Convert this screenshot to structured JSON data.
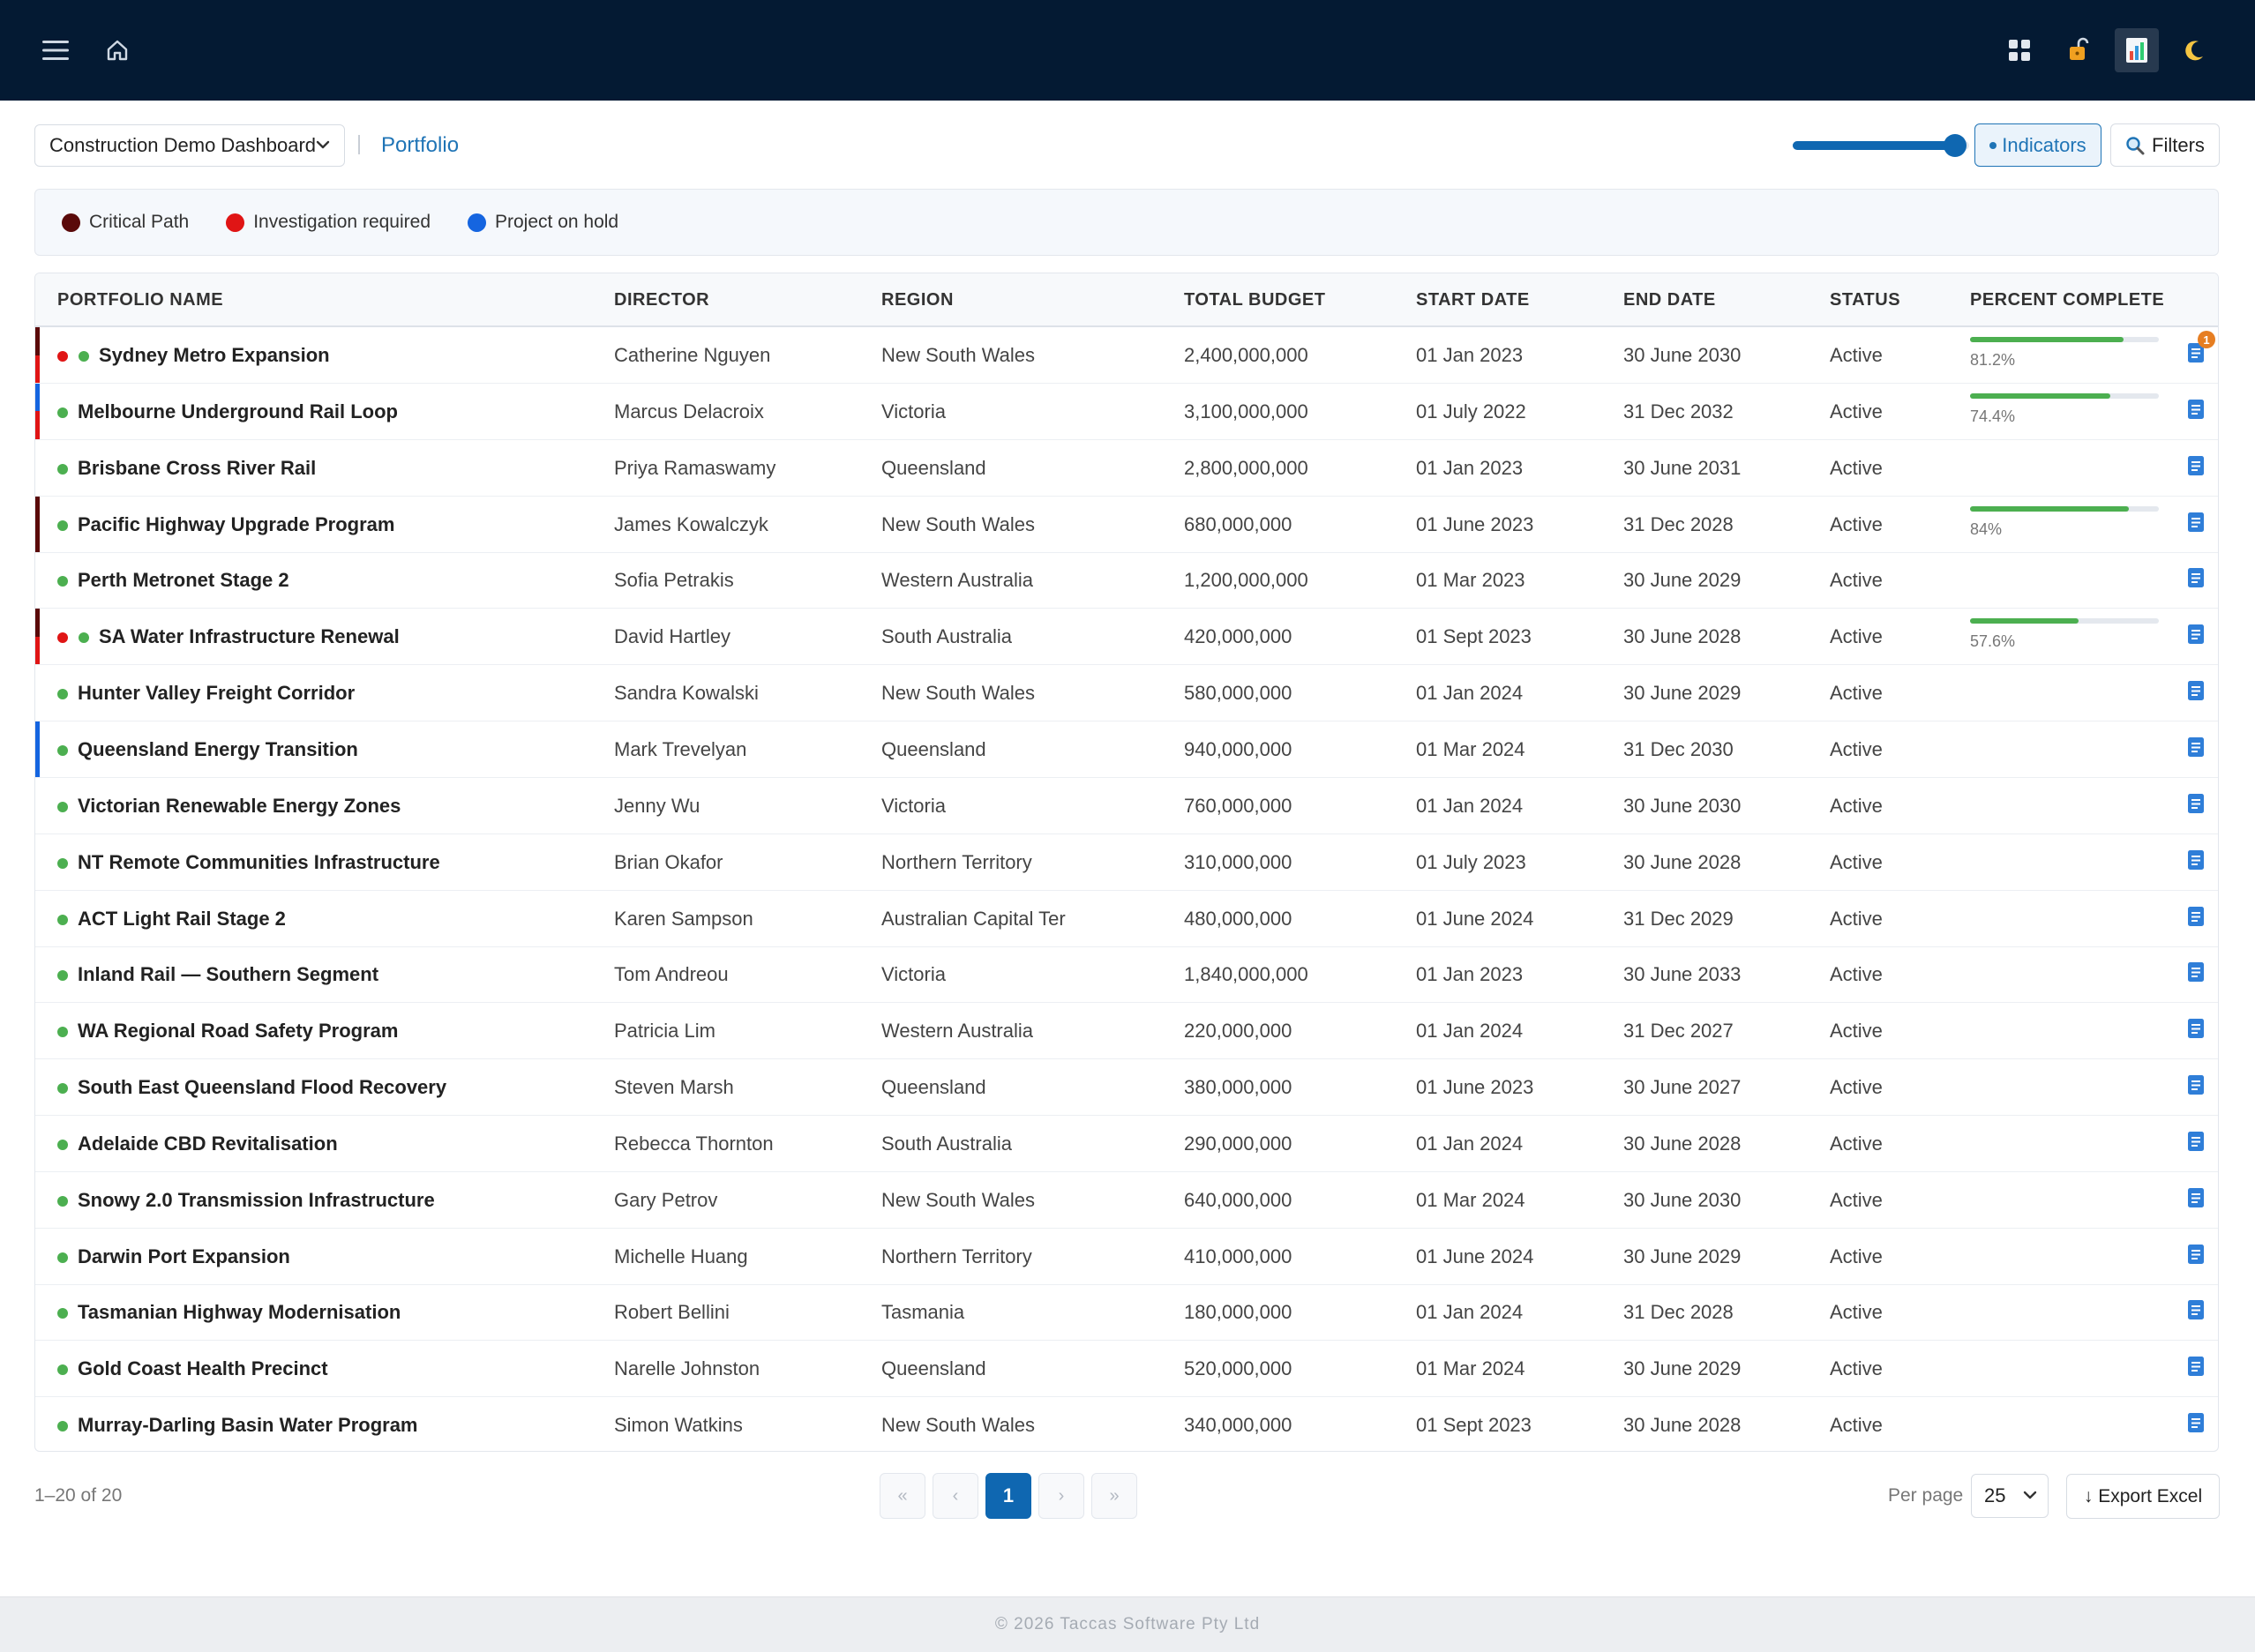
{
  "topbar": {
    "icons": [
      "menu-icon",
      "home-icon",
      "apps-grid-icon",
      "unlock-icon",
      "report-icon",
      "moon-icon"
    ]
  },
  "toolbar": {
    "dashboard_select": "Construction Demo Dashboard",
    "breadcrumb": "Portfolio",
    "slider_level": 0.92,
    "indicators_label": "Indicators",
    "filters_label": "Filters"
  },
  "legend": {
    "items": [
      {
        "label": "Critical Path",
        "color": "#5a0a0a"
      },
      {
        "label": "Investigation required",
        "color": "#e01515"
      },
      {
        "label": "Project on hold",
        "color": "#1565e0"
      }
    ]
  },
  "table": {
    "headers": [
      "PORTFOLIO NAME",
      "DIRECTOR",
      "REGION",
      "TOTAL BUDGET",
      "START DATE",
      "END DATE",
      "STATUS",
      "PERCENT COMPLETE"
    ],
    "rows": [
      {
        "name": "Sydney Metro Expansion",
        "director": "Catherine Nguyen",
        "region": "New South Wales",
        "budget": "2,400,000,000",
        "start": "01 Jan 2023",
        "end": "30 June 2030",
        "status": "Active",
        "progress": 81.2,
        "progress_label": "81.2%",
        "bars": [
          "#5a0a0a",
          "#e01515"
        ],
        "red_dot": true,
        "badge": "1"
      },
      {
        "name": "Melbourne Underground Rail Loop",
        "director": "Marcus Delacroix",
        "region": "Victoria",
        "budget": "3,100,000,000",
        "start": "01 July 2022",
        "end": "31 Dec 2032",
        "status": "Active",
        "progress": 74.4,
        "progress_label": "74.4%",
        "bars": [
          "#1565e0",
          "#e01515"
        ]
      },
      {
        "name": "Brisbane Cross River Rail",
        "director": "Priya Ramaswamy",
        "region": "Queensland",
        "budget": "2,800,000,000",
        "start": "01 Jan 2023",
        "end": "30 June 2031",
        "status": "Active"
      },
      {
        "name": "Pacific Highway Upgrade Program",
        "director": "James Kowalczyk",
        "region": "New South Wales",
        "budget": "680,000,000",
        "start": "01 June 2023",
        "end": "31 Dec 2028",
        "status": "Active",
        "progress": 84,
        "progress_label": "84%",
        "bars": [
          "#5a0a0a"
        ]
      },
      {
        "name": "Perth Metronet Stage 2",
        "director": "Sofia Petrakis",
        "region": "Western Australia",
        "budget": "1,200,000,000",
        "start": "01 Mar 2023",
        "end": "30 June 2029",
        "status": "Active"
      },
      {
        "name": "SA Water Infrastructure Renewal",
        "director": "David Hartley",
        "region": "South Australia",
        "budget": "420,000,000",
        "start": "01 Sept 2023",
        "end": "30 June 2028",
        "status": "Active",
        "progress": 57.6,
        "progress_label": "57.6%",
        "bars": [
          "#5a0a0a",
          "#e01515"
        ],
        "red_dot": true
      },
      {
        "name": "Hunter Valley Freight Corridor",
        "director": "Sandra Kowalski",
        "region": "New South Wales",
        "budget": "580,000,000",
        "start": "01 Jan 2024",
        "end": "30 June 2029",
        "status": "Active"
      },
      {
        "name": "Queensland Energy Transition",
        "director": "Mark Trevelyan",
        "region": "Queensland",
        "budget": "940,000,000",
        "start": "01 Mar 2024",
        "end": "31 Dec 2030",
        "status": "Active",
        "bars": [
          "#1565e0"
        ]
      },
      {
        "name": "Victorian Renewable Energy Zones",
        "director": "Jenny Wu",
        "region": "Victoria",
        "budget": "760,000,000",
        "start": "01 Jan 2024",
        "end": "30 June 2030",
        "status": "Active"
      },
      {
        "name": "NT Remote Communities Infrastructure",
        "director": "Brian Okafor",
        "region": "Northern Territory",
        "budget": "310,000,000",
        "start": "01 July 2023",
        "end": "30 June 2028",
        "status": "Active"
      },
      {
        "name": "ACT Light Rail Stage 2",
        "director": "Karen Sampson",
        "region": "Australian Capital Ter",
        "budget": "480,000,000",
        "start": "01 June 2024",
        "end": "31 Dec 2029",
        "status": "Active"
      },
      {
        "name": "Inland Rail — Southern Segment",
        "director": "Tom Andreou",
        "region": "Victoria",
        "budget": "1,840,000,000",
        "start": "01 Jan 2023",
        "end": "30 June 2033",
        "status": "Active"
      },
      {
        "name": "WA Regional Road Safety Program",
        "director": "Patricia Lim",
        "region": "Western Australia",
        "budget": "220,000,000",
        "start": "01 Jan 2024",
        "end": "31 Dec 2027",
        "status": "Active"
      },
      {
        "name": "South East Queensland Flood Recovery",
        "director": "Steven Marsh",
        "region": "Queensland",
        "budget": "380,000,000",
        "start": "01 June 2023",
        "end": "30 June 2027",
        "status": "Active"
      },
      {
        "name": "Adelaide CBD Revitalisation",
        "director": "Rebecca Thornton",
        "region": "South Australia",
        "budget": "290,000,000",
        "start": "01 Jan 2024",
        "end": "30 June 2028",
        "status": "Active"
      },
      {
        "name": "Snowy 2.0 Transmission Infrastructure",
        "director": "Gary Petrov",
        "region": "New South Wales",
        "budget": "640,000,000",
        "start": "01 Mar 2024",
        "end": "30 June 2030",
        "status": "Active"
      },
      {
        "name": "Darwin Port Expansion",
        "director": "Michelle Huang",
        "region": "Northern Territory",
        "budget": "410,000,000",
        "start": "01 June 2024",
        "end": "30 June 2029",
        "status": "Active"
      },
      {
        "name": "Tasmanian Highway Modernisation",
        "director": "Robert Bellini",
        "region": "Tasmania",
        "budget": "180,000,000",
        "start": "01 Jan 2024",
        "end": "31 Dec 2028",
        "status": "Active"
      },
      {
        "name": "Gold Coast Health Precinct",
        "director": "Narelle Johnston",
        "region": "Queensland",
        "budget": "520,000,000",
        "start": "01 Mar 2024",
        "end": "30 June 2029",
        "status": "Active"
      },
      {
        "name": "Murray-Darling Basin Water Program",
        "director": "Simon Watkins",
        "region": "New South Wales",
        "budget": "340,000,000",
        "start": "01 Sept 2023",
        "end": "30 June 2028",
        "status": "Active"
      }
    ]
  },
  "pagination": {
    "count_text": "1–20 of 20",
    "first": "«",
    "prev": "‹",
    "current": "1",
    "next": "›",
    "last": "»",
    "per_page_label": "Per page",
    "per_page_value": "25",
    "export_label": "↓ Export Excel"
  },
  "footer": {
    "copyright": "© 2026 Taccas Software Pty Ltd"
  },
  "colors": {
    "topbar": "#041a33",
    "accent": "#0f67b1",
    "status_green": "#4caf50"
  }
}
